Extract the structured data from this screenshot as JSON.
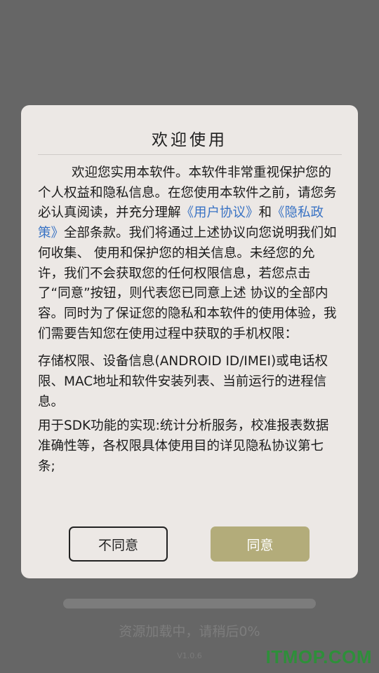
{
  "dialog": {
    "title": "欢迎使用",
    "intro_before_user_agreement": "欢迎您实用本软件。本软件非常重视保护您的个人权益和隐私信息。在您使用本软件之前，请您务必认真阅读，并充分理解",
    "user_agreement_link": "《用户协议》",
    "and_text": "和",
    "privacy_policy_link": "《隐私政策》",
    "intro_after_privacy_policy": "全部条款。我们将通过上述协议向您说明我们如何收集、 使用和保护您的相关信息。未经您的允许，我们不会获取您的任何权限信息，若您点击了“同意”按钮，则代表您已同意上述 协议的全部内容。同时为了保证您的隐私和本软件的使用体验，我们需要告知您在使用过程中获取的手机权限：",
    "permissions_paragraph": "存储权限、设备信息(ANDROID ID/IMEI)或电话权限、MAC地址和软件安装列表、当前运行的进程信息。",
    "sdk_paragraph": "用于SDK功能的实现:统计分析服务，校准报表数据准确性等，各权限具体使用目的详见隐私协议第七条;",
    "disagree_label": "不同意",
    "agree_label": "同意"
  },
  "loading": {
    "text": "资源加载中，请稍后0%",
    "progress_percent": 0,
    "version": "V1.0.6"
  },
  "watermark": {
    "text": "ITMOP.COM"
  },
  "colors": {
    "link": "#3a73c4",
    "agree_button": "#b3ac7a",
    "dialog_bg": "#ece8e5",
    "watermark": "#2e8f3a"
  }
}
